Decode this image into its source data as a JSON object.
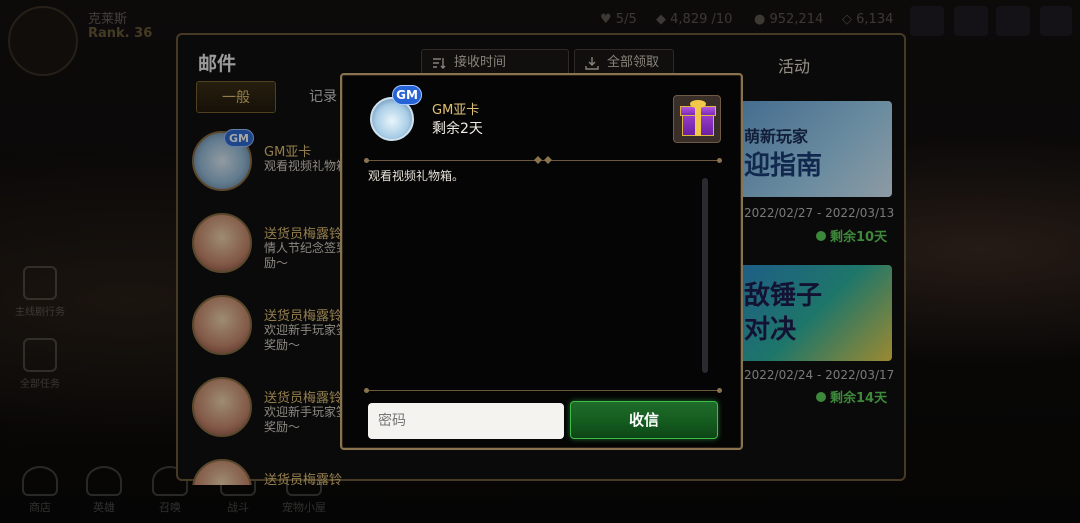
{
  "player": {
    "name": "克莱斯",
    "rank": "Rank. 36"
  },
  "currencies": [
    {
      "icon": "heart-icon",
      "value": "5/5"
    },
    {
      "icon": "crystal-icon",
      "value": "4,829 /10"
    },
    {
      "icon": "gold-icon",
      "value": "952,214"
    },
    {
      "icon": "gem-icon",
      "value": "6,134"
    }
  ],
  "side_menu": [
    {
      "label": "主线剧行务"
    },
    {
      "label": "全部任务"
    }
  ],
  "bottom_nav": [
    "商店",
    "英雄",
    "召唤",
    "战斗",
    "宠物小屋"
  ],
  "mail": {
    "title": "邮件",
    "tabs": [
      "一般",
      "记录"
    ],
    "sort_label": "接收时间",
    "claim_all_label": "全部领取",
    "items": [
      {
        "sender": "GM亚卡",
        "preview": "观看视频礼物箱。",
        "gm": "GM"
      },
      {
        "sender": "送货员梅露铃",
        "preview": "情人节纪念签到奖励～"
      },
      {
        "sender": "送货员梅露铃",
        "preview": "欢迎新手玩家签到奖励～"
      },
      {
        "sender": "送货员梅露铃",
        "preview": "欢迎新手玩家签到奖励～"
      },
      {
        "sender": "送货员梅露铃",
        "preview": ""
      }
    ]
  },
  "events": {
    "title": "活动",
    "items": [
      {
        "banner_top": "萌新玩家",
        "banner_text": "迎指南",
        "date": "2022/02/27 - 2022/03/13",
        "remain": "剩余10天"
      },
      {
        "banner_top": "",
        "banner_text": "敌锤子对决",
        "date": "2022/02/24 - 2022/03/17",
        "remain": "剩余14天"
      }
    ]
  },
  "modal": {
    "gm_badge": "GM",
    "sender": "GM亚卡",
    "remain": "剩余2天",
    "body": "观看视频礼物箱。",
    "password_placeholder": "密码",
    "receive_label": "收信"
  }
}
